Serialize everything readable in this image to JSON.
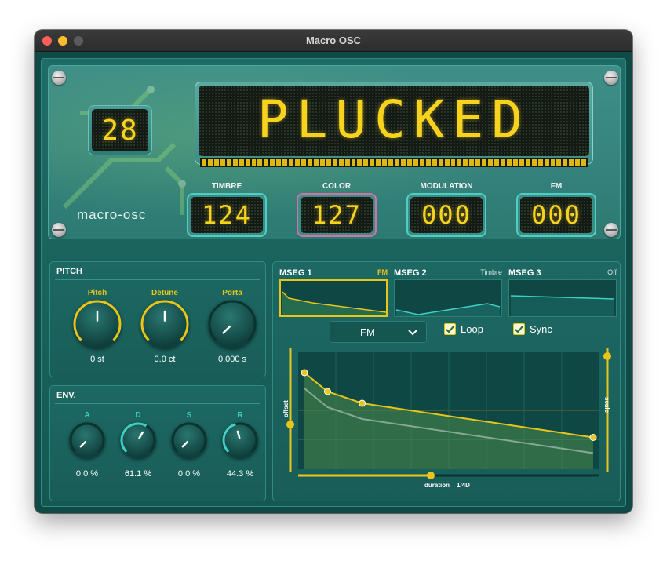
{
  "window": {
    "title": "Macro OSC"
  },
  "display": {
    "preset_number": "28",
    "preset_name": "PLUCKED",
    "brand": "macro-osc",
    "level_fraction": 1.0
  },
  "params": [
    {
      "label": "TIMBRE",
      "value": "124"
    },
    {
      "label": "COLOR",
      "value": "127"
    },
    {
      "label": "MODULATION",
      "value": "000"
    },
    {
      "label": "FM",
      "value": "000"
    }
  ],
  "pitch": {
    "title": "PITCH",
    "knobs": [
      {
        "label": "Pitch",
        "value": "0 st",
        "level": 0.5
      },
      {
        "label": "Detune",
        "value": "0.0 ct",
        "level": 0.5
      },
      {
        "label": "Porta",
        "value": "0.000 s",
        "level": 0.0
      }
    ]
  },
  "env": {
    "title": "ENV.",
    "knobs": [
      {
        "label": "A",
        "value": "0.0 %",
        "level": 0.0
      },
      {
        "label": "D",
        "value": "61.1 %",
        "level": 0.611
      },
      {
        "label": "S",
        "value": "0.0 %",
        "level": 0.0
      },
      {
        "label": "R",
        "value": "44.3 %",
        "level": 0.443
      }
    ]
  },
  "mseg": {
    "tabs": [
      {
        "name": "MSEG 1",
        "tag": "FM",
        "active": true
      },
      {
        "name": "MSEG 2",
        "tag": "Timbre",
        "active": false
      },
      {
        "name": "MSEG 3",
        "tag": "Off",
        "active": false
      }
    ],
    "target": "FM",
    "loop_label": "Loop",
    "loop_checked": true,
    "sync_label": "Sync",
    "sync_checked": true,
    "offset_label": "offset",
    "scale_label": "scale",
    "duration_label": "duration",
    "duration_value": "1/4D",
    "envelope_points": [
      {
        "t": 0.0,
        "v": 0.82
      },
      {
        "t": 0.08,
        "v": 0.66
      },
      {
        "t": 0.2,
        "v": 0.56
      },
      {
        "t": 1.0,
        "v": 0.27
      }
    ],
    "offset_level": 0.38,
    "scale_level": 1.0,
    "duration_level": 0.44
  },
  "colors": {
    "accent_yellow": "#e8c51a",
    "accent_teal": "#3fd0c4",
    "accent_pink": "#d270a8",
    "lcd_text": "#f7d31e"
  }
}
